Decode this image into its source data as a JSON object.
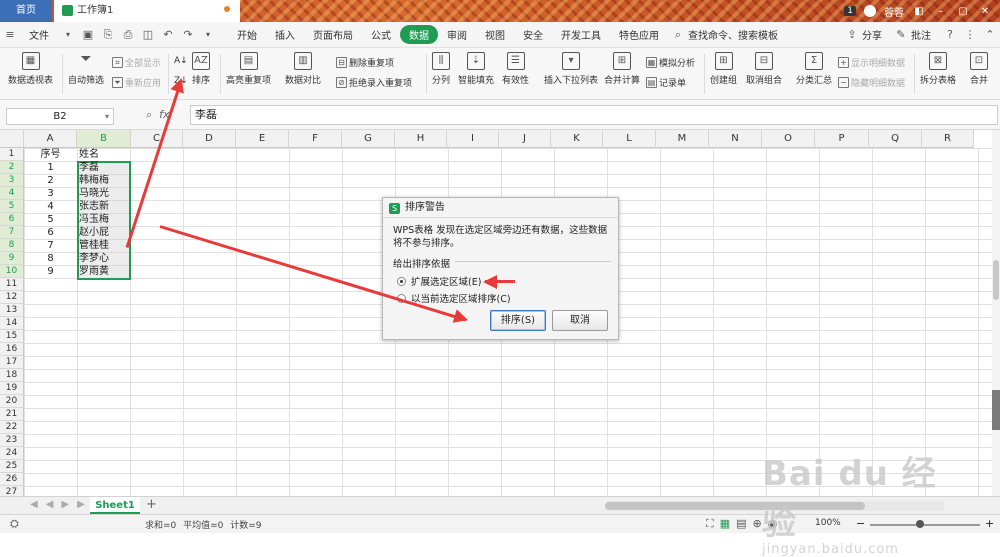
{
  "titlebar": {
    "home_tab": "首页",
    "doc_tab": "工作簿1",
    "badge_count": "1",
    "user_name": "蓉蓉"
  },
  "menubar": {
    "file_label": "文件",
    "items": [
      "开始",
      "插入",
      "页面布局",
      "公式",
      "数据",
      "审阅",
      "视图",
      "安全",
      "开发工具",
      "特色应用"
    ],
    "active_item": "数据",
    "search_label": "查找命令、搜索模板",
    "share_label": "分享",
    "comment_label": "批注"
  },
  "ribbon": {
    "pivot_table": "数据透视表",
    "auto_filter": "自动筛选",
    "show_all": "全部显示",
    "reapply": "重新应用",
    "sort": "排序",
    "highlight_dup": "高亮重复项",
    "data_compare": "数据对比",
    "delete_dup": "删除重复项",
    "reject_dup": "拒绝录入重复项",
    "split_col": "分列",
    "smart_fill": "智能填充",
    "validity": "有效性",
    "insert_dropdown": "插入下拉列表",
    "merge_calc": "合并计算",
    "simulate": "模拟分析",
    "record_sheet": "记录单",
    "create_group": "创建组",
    "ungroup": "取消组合",
    "subtotal": "分类汇总",
    "show_detail": "显示明细数据",
    "hide_detail": "隐藏明细数据",
    "split_table": "拆分表格",
    "merge_table": "合并"
  },
  "formulabar": {
    "cell_ref": "B2",
    "fx_label": "fx",
    "content": "李磊"
  },
  "grid": {
    "columns": [
      "A",
      "B",
      "C",
      "D",
      "E",
      "F",
      "G",
      "H",
      "I",
      "J",
      "K",
      "L",
      "M",
      "N",
      "O",
      "P",
      "Q",
      "R"
    ],
    "rows": [
      "1",
      "2",
      "3",
      "4",
      "5",
      "6",
      "7",
      "8",
      "9",
      "10",
      "11",
      "12",
      "13",
      "14",
      "15",
      "16",
      "17",
      "18",
      "19",
      "20",
      "21",
      "22",
      "23",
      "24",
      "25",
      "26",
      "27"
    ],
    "header": {
      "a": "序号",
      "b": "姓名"
    },
    "data": [
      {
        "a": "1",
        "b": "李磊"
      },
      {
        "a": "2",
        "b": "韩梅梅"
      },
      {
        "a": "3",
        "b": "马晓光"
      },
      {
        "a": "4",
        "b": "张志新"
      },
      {
        "a": "5",
        "b": "冯玉梅"
      },
      {
        "a": "6",
        "b": "赵小屁"
      },
      {
        "a": "7",
        "b": "管桂桂"
      },
      {
        "a": "8",
        "b": "李梦心"
      },
      {
        "a": "9",
        "b": "罗雨黄"
      }
    ]
  },
  "dialog": {
    "title": "排序警告",
    "message": "WPS表格 发现在选定区域旁边还有数据，这些数据将不参与排序。",
    "group_label": "给出排序依据",
    "option_expand": "扩展选定区域(E)",
    "option_current": "以当前选定区域排序(C)",
    "sort_button": "排序(S)",
    "cancel_button": "取消"
  },
  "sheetbar": {
    "sheet_name": "Sheet1",
    "add_label": "+"
  },
  "statusbar": {
    "summary": "求和=0  平均值=0  计数=9",
    "zoom": "100%"
  },
  "watermark": {
    "brand": "Bai du 经验",
    "url": "jingyan.baidu.com"
  },
  "colors": {
    "accent": "#1f9b53",
    "arrow": "#e73b3b",
    "home_tab": "#3b70b8"
  }
}
